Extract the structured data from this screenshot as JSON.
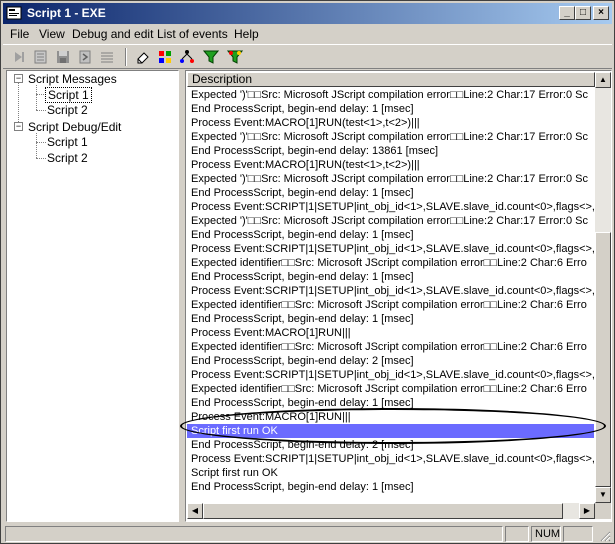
{
  "window": {
    "title": "Script 1 - EXE"
  },
  "menu": [
    "File",
    "View",
    "Debug and edit",
    "List of events",
    "Help"
  ],
  "toolbar": [
    "step-icon",
    "list-icon",
    "save-icon",
    "script-icon",
    "lines-icon",
    "eraser-icon",
    "palette-icon",
    "tree-icon",
    "filter-green-icon",
    "filter-multi-icon"
  ],
  "tree": {
    "root1": "Script Messages",
    "root1_children": [
      "Script 1",
      "Script 2"
    ],
    "root2": "Script Debug/Edit",
    "root2_children": [
      "Script 1",
      "Script 2"
    ]
  },
  "list": {
    "header": "Description",
    "rows": [
      "Expected ')'□□Src: Microsoft JScript compilation error□□Line:2 Char:17 Error:0 Sc",
      "End ProcessScript, begin-end delay: 1 [msec]",
      "Process Event:MACRO[1]RUN(test<1>,t<2>)|||",
      "Expected ')'□□Src: Microsoft JScript compilation error□□Line:2 Char:17 Error:0 Sc",
      "End ProcessScript, begin-end delay: 13861 [msec]",
      "Process Event:MACRO[1]RUN(test<1>,t<2>)|||",
      "Expected ')'□□Src: Microsoft JScript compilation error□□Line:2 Char:17 Error:0 Sc",
      "End ProcessScript, begin-end delay: 1 [msec]",
      "Process Event:SCRIPT|1|SETUP|int_obj_id<1>,SLAVE.slave_id.count<0>,flags<>,",
      "Expected ')'□□Src: Microsoft JScript compilation error□□Line:2 Char:17 Error:0 Sc",
      "End ProcessScript, begin-end delay: 1 [msec]",
      "Process Event:SCRIPT|1|SETUP|int_obj_id<1>,SLAVE.slave_id.count<0>,flags<>,",
      "Expected identifier□□Src: Microsoft JScript compilation error□□Line:2 Char:6 Erro",
      "End ProcessScript, begin-end delay: 1 [msec]",
      "Process Event:SCRIPT|1|SETUP|int_obj_id<1>,SLAVE.slave_id.count<0>,flags<>,",
      "Expected identifier□□Src: Microsoft JScript compilation error□□Line:2 Char:6 Erro",
      "End ProcessScript, begin-end delay: 1 [msec]",
      "Process Event:MACRO[1]RUN|||",
      "Expected identifier□□Src: Microsoft JScript compilation error□□Line:2 Char:6 Erro",
      "End ProcessScript, begin-end delay: 2 [msec]",
      "Process Event:SCRIPT|1|SETUP|int_obj_id<1>,SLAVE.slave_id.count<0>,flags<>,",
      "Expected identifier□□Src: Microsoft JScript compilation error□□Line:2 Char:6 Erro",
      "End ProcessScript, begin-end delay: 1 [msec]",
      "Process Event:MACRO[1]RUN|||",
      "Script first run OK",
      "End ProcessScript, begin-end delay: 2 [msec]",
      "Process Event:SCRIPT|1|SETUP|int_obj_id<1>,SLAVE.slave_id.count<0>,flags<>,",
      "Script first run OK",
      "End ProcessScript, begin-end delay: 1 [msec]"
    ],
    "selected_index": 24
  },
  "status": {
    "num": "NUM"
  },
  "colors": {
    "selection": "#6b6bff",
    "title_start": "#0a246a",
    "title_end": "#a6caf0"
  }
}
